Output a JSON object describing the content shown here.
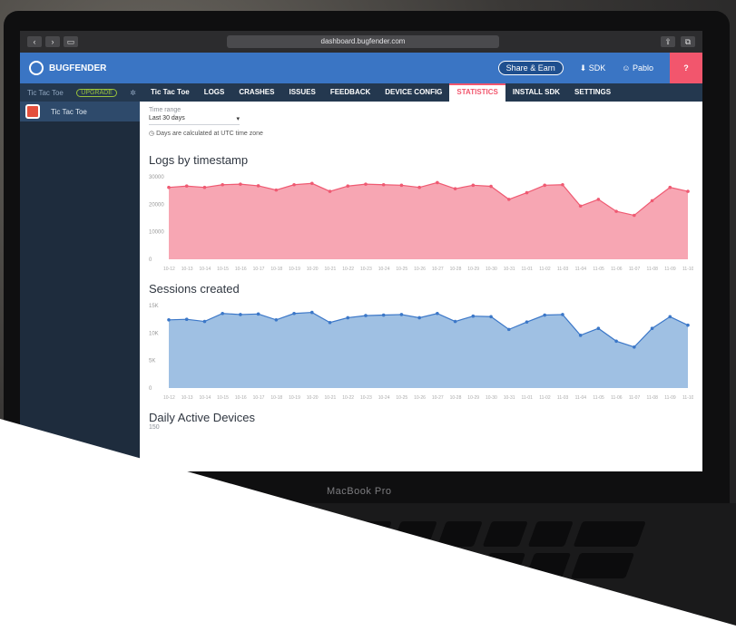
{
  "browser": {
    "url": "dashboard.bugfender.com"
  },
  "header": {
    "brand": "BUGFENDER",
    "share": "Share & Earn",
    "sdk": "SDK",
    "user": "Pablo",
    "help": "?"
  },
  "nav": {
    "app_name": "Tic Tac Toe",
    "upgrade": "UPGRADE",
    "tabs": [
      "Tic Tac Toe",
      "LOGS",
      "CRASHES",
      "ISSUES",
      "FEEDBACK",
      "DEVICE CONFIG",
      "STATISTICS",
      "INSTALL SDK",
      "SETTINGS"
    ]
  },
  "sidebar": {
    "app_label": "Tic Tac Toe"
  },
  "filters": {
    "label": "Time range",
    "value": "Last 30 days",
    "hint": "Days are calculated at UTC time zone"
  },
  "colors": {
    "logs": "#f7a6b3",
    "logs_line": "#ef5a72",
    "sessions": "#9fc0e3",
    "sessions_line": "#3b77c8",
    "header": "#3a75c4",
    "nav": "#24384f"
  },
  "chart_data": [
    {
      "type": "area",
      "title": "Logs by timestamp",
      "yticks": [
        "30000",
        "20000",
        "10000",
        "0"
      ],
      "categories": [
        "10-12",
        "10-13",
        "10-14",
        "10-15",
        "10-16",
        "10-17",
        "10-18",
        "10-19",
        "10-20",
        "10-21",
        "10-22",
        "10-23",
        "10-24",
        "10-25",
        "10-26",
        "10-27",
        "10-28",
        "10-29",
        "10-30",
        "10-31",
        "11-01",
        "11-02",
        "11-03",
        "11-04",
        "11-05",
        "11-06",
        "11-07",
        "11-08",
        "11-09",
        "11-10"
      ],
      "values": [
        27000,
        27500,
        27000,
        28000,
        28200,
        27600,
        26000,
        28000,
        28500,
        25500,
        27500,
        28200,
        28000,
        27800,
        27000,
        28800,
        26500,
        27800,
        27400,
        22500,
        25000,
        27800,
        28000,
        20000,
        22500,
        18000,
        16500,
        22000,
        27000,
        25500
      ],
      "ylim": [
        0,
        32000
      ]
    },
    {
      "type": "area",
      "title": "Sessions created",
      "yticks": [
        "15K",
        "10K",
        "5K",
        "0"
      ],
      "categories": [
        "10-12",
        "10-13",
        "10-14",
        "10-15",
        "10-16",
        "10-17",
        "10-18",
        "10-19",
        "10-20",
        "10-21",
        "10-22",
        "10-23",
        "10-24",
        "10-25",
        "10-26",
        "10-27",
        "10-28",
        "10-29",
        "10-30",
        "10-31",
        "11-01",
        "11-02",
        "11-03",
        "11-04",
        "11-05",
        "11-06",
        "11-07",
        "11-08",
        "11-09",
        "11-10"
      ],
      "values": [
        12800,
        12900,
        12500,
        14000,
        13800,
        13900,
        12800,
        14000,
        14200,
        12300,
        13200,
        13600,
        13700,
        13800,
        13200,
        14000,
        12500,
        13500,
        13400,
        11000,
        12400,
        13700,
        13800,
        9900,
        11200,
        8800,
        7700,
        11200,
        13400,
        11800
      ],
      "ylim": [
        0,
        16000
      ]
    },
    {
      "type": "area",
      "title": "Daily Active Devices",
      "yticks": [
        "150"
      ]
    }
  ]
}
